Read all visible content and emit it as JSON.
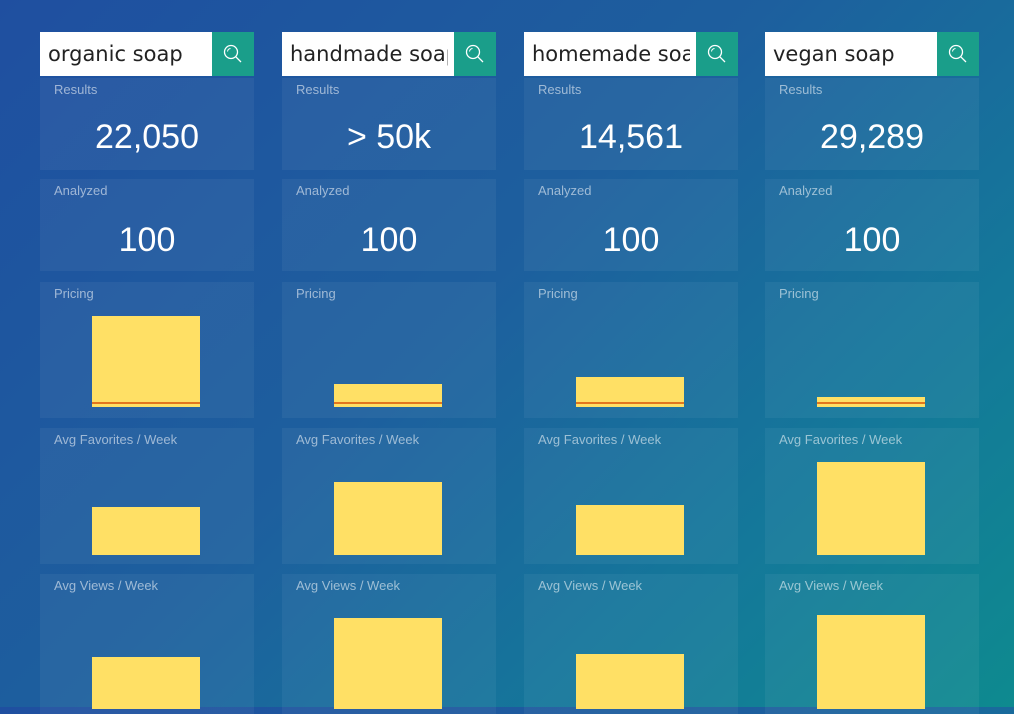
{
  "labels": {
    "results": "Results",
    "analyzed": "Analyzed",
    "pricing": "Pricing",
    "favorites": "Avg Favorites / Week",
    "views": "Avg Views / Week"
  },
  "colors": {
    "bar": "#ffe065",
    "median_line": "#e2761e",
    "search_button": "#1a9e8a"
  },
  "columns": [
    {
      "query": "organic soap",
      "results": "22,050",
      "analyzed": "100",
      "pricing_level": 0.98,
      "favorites_level": 0.52,
      "views_level": 0.55
    },
    {
      "query": "handmade soap",
      "results": "> 50k",
      "analyzed": "100",
      "pricing_level": 0.25,
      "favorites_level": 0.78,
      "views_level": 0.97
    },
    {
      "query": "homemade soap",
      "results": "14,561",
      "analyzed": "100",
      "pricing_level": 0.32,
      "favorites_level": 0.54,
      "views_level": 0.58
    },
    {
      "query": "vegan soap",
      "results": "29,289",
      "analyzed": "100",
      "pricing_level": 0.11,
      "favorites_level": 1.0,
      "views_level": 1.0
    }
  ]
}
